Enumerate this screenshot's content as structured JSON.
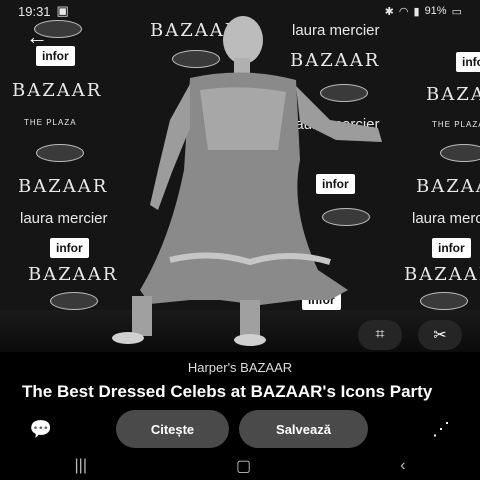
{
  "status": {
    "time": "19:31",
    "battery": "91%"
  },
  "photo": {
    "logos": {
      "bazaar": "BAZAAR",
      "laura": "laura mercier",
      "infor": "infor",
      "plaza": "THE PLAZA"
    }
  },
  "article": {
    "source": "Harper's BAZAAR",
    "title": "The Best Dressed Celebs at BAZAAR's Icons Party"
  },
  "actions": {
    "read_label": "Citește",
    "save_label": "Salvează"
  },
  "icons": [
    "back-arrow",
    "lens-scan",
    "scissors",
    "chat",
    "share"
  ]
}
